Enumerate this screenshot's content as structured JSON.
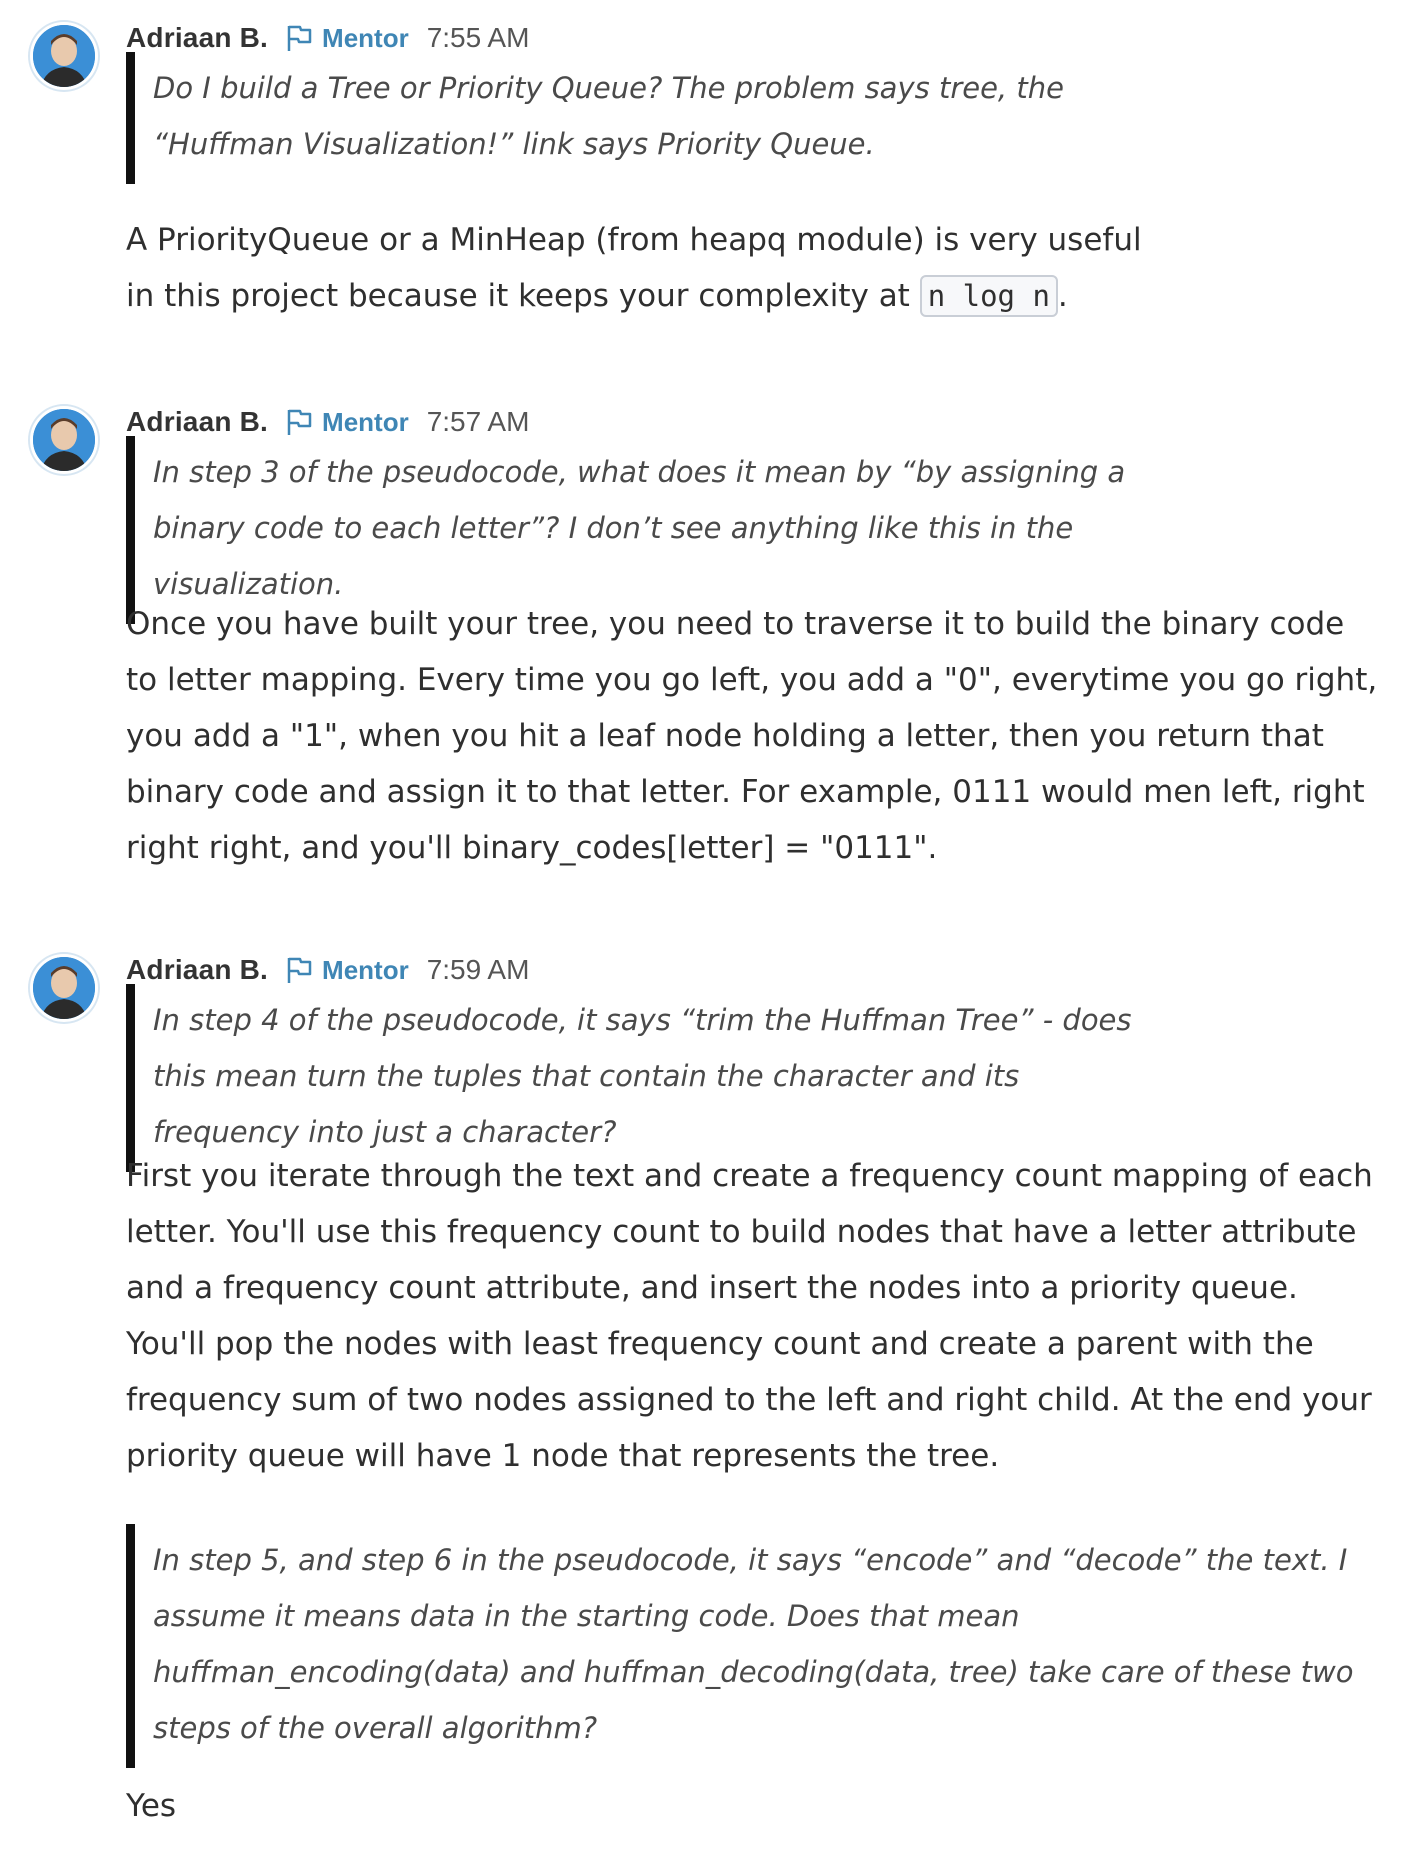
{
  "messages": [
    {
      "author": "Adriaan B.",
      "role": "Mentor",
      "time": "7:55 AM",
      "quote": "Do I build a Tree or Priority Queue? The problem says tree, the “Huffman Visualization!” link says Priority Queue.",
      "reply_before_code": "A PriorityQueue or a MinHeap (from heapq module) is very useful in this project because it keeps your complexity at ",
      "reply_code": "n log n",
      "reply_after_code": "."
    },
    {
      "author": "Adriaan B.",
      "role": "Mentor",
      "time": "7:57 AM",
      "quote": "In step 3 of the pseudocode, what does it mean by “by assigning a binary code to each letter”? I don’t see anything like this in the visualization.",
      "reply": "Once you have built your tree, you need to traverse it to build the binary code to letter mapping. Every time you go left, you add a \"0\", everytime you go right, you add a \"1\", when you hit a leaf node holding a letter, then you return that binary code and assign it to that letter. For example, 0111 would men left, right right right, and you'll binary_codes[letter] = \"0111\"."
    },
    {
      "author": "Adriaan B.",
      "role": "Mentor",
      "time": "7:59 AM",
      "quote": "In step 4 of the pseudocode, it says “trim the Huffman Tree” - does this mean turn the tuples that contain the character and its frequency into just a character?",
      "reply": "First you iterate through the text and create a frequency count mapping of each letter. You'll use this frequency count to build nodes that have a letter attribute and a frequency count attribute, and insert the nodes into a priority queue. You'll pop the nodes with least frequency count and create a parent with the frequency sum of two nodes assigned to the left and right child. At the end your priority queue will have 1 node that represents the tree.",
      "quote2": "In step 5, and step 6 in the pseudocode, it says “encode” and “decode” the text. I assume it means data in the starting code. Does that mean huffman_encoding(data) and huffman_decoding(data, tree) take care of these two steps of the overall algorithm?",
      "reply2": "Yes"
    }
  ],
  "icons": {
    "role_flag": "flag-icon",
    "avatar": "avatar"
  },
  "colors": {
    "mentor": "#3f86b5",
    "quote_bar": "#111111",
    "avatar_bg": "#3b8fd6"
  }
}
